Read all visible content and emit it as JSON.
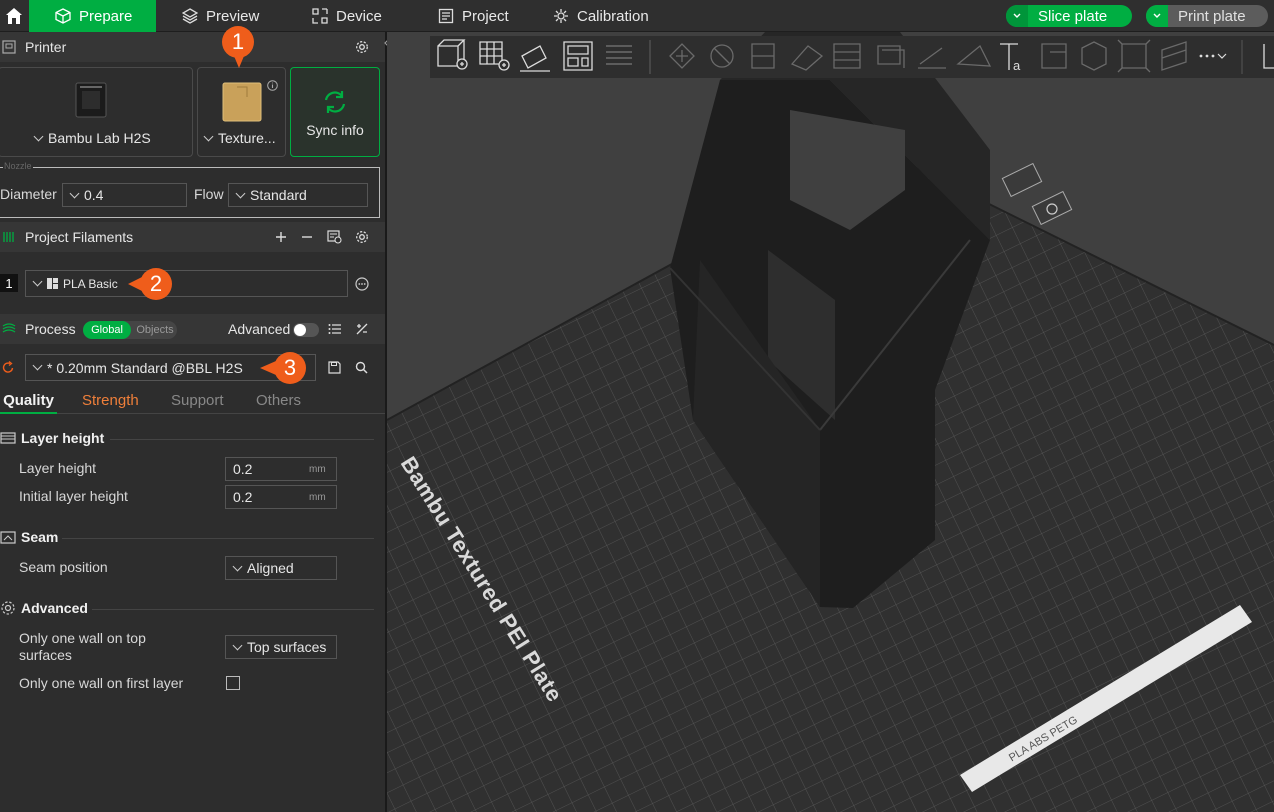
{
  "topbar": {
    "tabs": [
      {
        "label": "Prepare",
        "icon": "cube-icon"
      },
      {
        "label": "Preview",
        "icon": "layers-icon"
      },
      {
        "label": "Device",
        "icon": "device-icon"
      },
      {
        "label": "Project",
        "icon": "project-icon"
      },
      {
        "label": "Calibration",
        "icon": "calibration-icon"
      }
    ],
    "slice_label": "Slice plate",
    "print_label": "Print plate"
  },
  "printer": {
    "title": "Printer",
    "printer_name": "Bambu Lab H2S",
    "plate_name": "Texture...",
    "sync_label": "Sync info",
    "nozzle_caption": "Nozzle",
    "diameter_label": "Diameter",
    "diameter_value": "0.4",
    "flow_label": "Flow",
    "flow_value": "Standard"
  },
  "filaments": {
    "title": "Project Filaments",
    "items": [
      {
        "index": "1",
        "name": "PLA Basic"
      }
    ]
  },
  "process": {
    "title": "Process",
    "scope_global": "Global",
    "scope_objects": "Objects",
    "advanced_label": "Advanced",
    "preset": "* 0.20mm Standard @BBL H2S",
    "tabs": [
      "Quality",
      "Strength",
      "Support",
      "Others"
    ],
    "groups": {
      "layer_height": {
        "title": "Layer height",
        "layer_height_label": "Layer height",
        "layer_height_value": "0.2",
        "initial_label": "Initial layer height",
        "initial_value": "0.2",
        "unit": "mm"
      },
      "seam": {
        "title": "Seam",
        "position_label": "Seam position",
        "position_value": "Aligned"
      },
      "advanced": {
        "title": "Advanced",
        "top_wall_label_1": "Only one wall on top",
        "top_wall_label_2": "surfaces",
        "top_wall_value": "Top surfaces",
        "first_layer_label": "Only one wall on first layer"
      }
    }
  },
  "callouts": [
    "1",
    "2",
    "3"
  ],
  "viewport": {
    "plate_label": "Bambu Textured PEI Plate",
    "strip_label": "PLA ABS PETG"
  },
  "colors": {
    "accent": "#00ae42",
    "badge": "#ef5d1b",
    "strength_tab": "#ef7f3a"
  }
}
